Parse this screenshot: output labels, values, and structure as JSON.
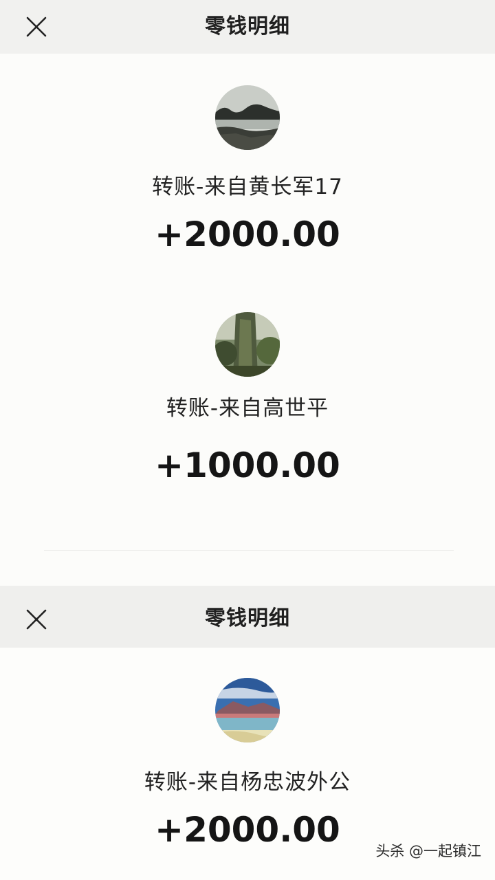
{
  "screen_1": {
    "title": "零钱明细",
    "close_icon": "close-icon",
    "entries": [
      {
        "label": "转账-来自黄长军17",
        "amount": "+2000.00",
        "avatar": "lake-landscape-avatar"
      },
      {
        "label": "转账-来自高世平",
        "amount": "+1000.00",
        "avatar": "tree-forest-avatar"
      }
    ]
  },
  "screen_2": {
    "title": "零钱明细",
    "close_icon": "close-icon",
    "entries": [
      {
        "label": "转账-来自杨忠波外公",
        "amount": "+2000.00",
        "avatar": "mountain-lake-avatar"
      }
    ]
  },
  "watermark": "头杀 @一起镇江",
  "colors": {
    "background": "#fcfcfa",
    "header": "#f1f1ef",
    "text": "#1b1b1b"
  }
}
